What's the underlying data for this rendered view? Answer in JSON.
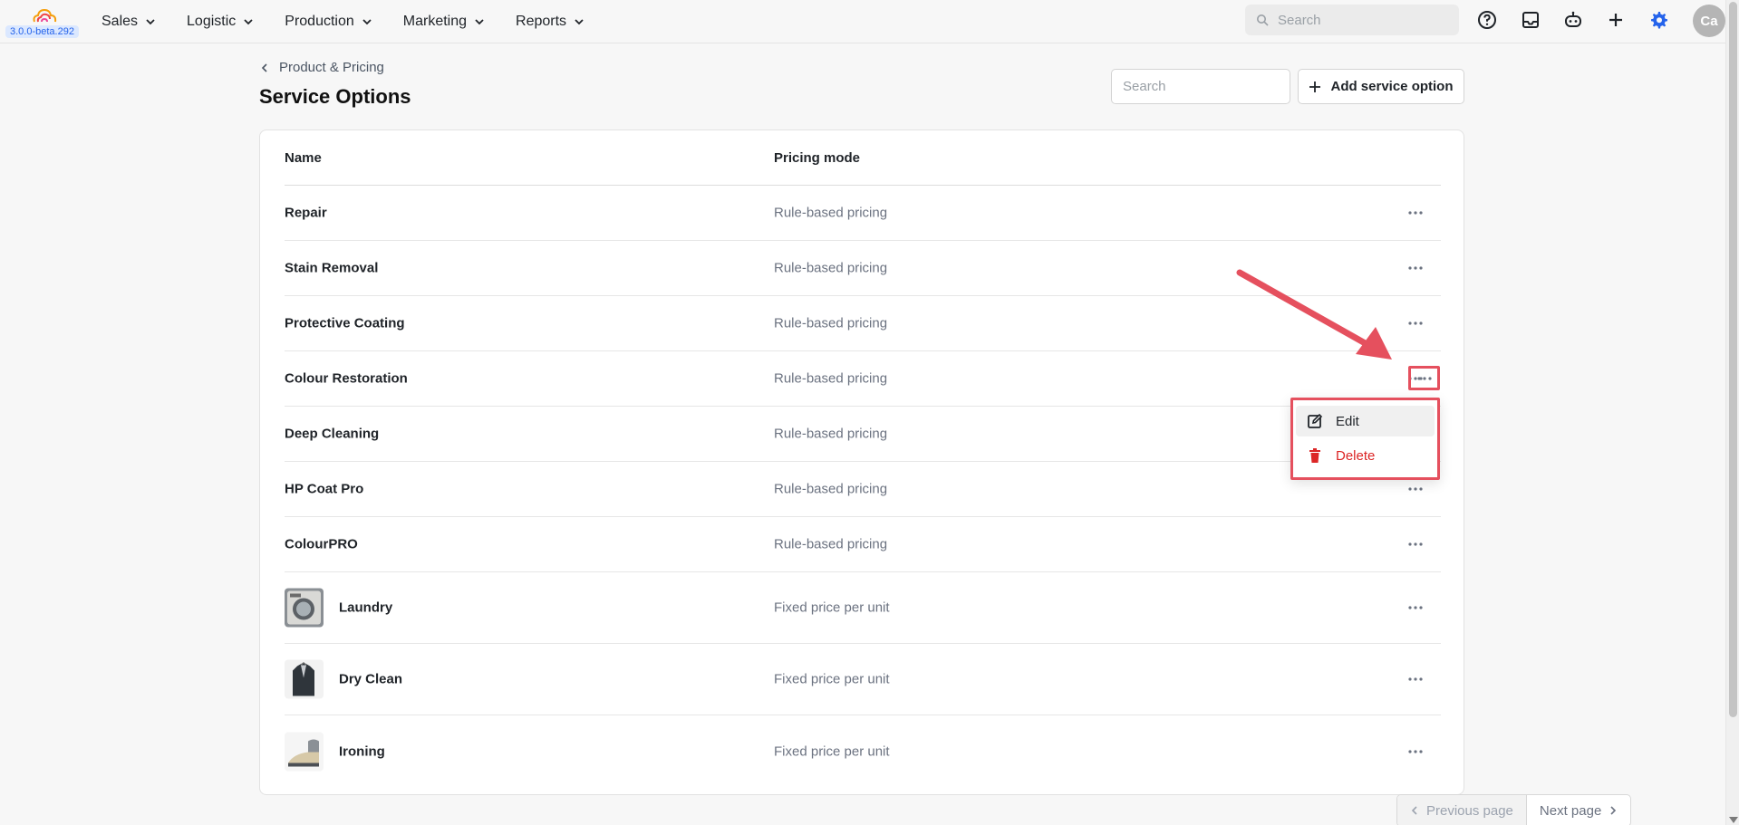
{
  "app": {
    "version": "3.0.0-beta.292"
  },
  "nav": {
    "items": [
      {
        "label": "Sales"
      },
      {
        "label": "Logistic"
      },
      {
        "label": "Production"
      },
      {
        "label": "Marketing"
      },
      {
        "label": "Reports"
      }
    ]
  },
  "topbar": {
    "search_placeholder": "Search",
    "avatar_initials": "Ca",
    "icons": [
      "help-icon",
      "inbox-icon",
      "robot-icon",
      "plus-icon",
      "settings-icon"
    ],
    "settings_color": "#2563eb"
  },
  "page": {
    "breadcrumb": "Product & Pricing",
    "title": "Service Options",
    "search_placeholder": "Search",
    "add_button_label": "Add service option"
  },
  "table": {
    "columns": {
      "name": "Name",
      "pricing_mode": "Pricing mode"
    },
    "rows": [
      {
        "name": "Repair",
        "pricing_mode": "Rule-based pricing",
        "thumb": ""
      },
      {
        "name": "Stain Removal",
        "pricing_mode": "Rule-based pricing",
        "thumb": ""
      },
      {
        "name": "Protective Coating",
        "pricing_mode": "Rule-based pricing",
        "thumb": ""
      },
      {
        "name": "Colour Restoration",
        "pricing_mode": "Rule-based pricing",
        "thumb": ""
      },
      {
        "name": "Deep Cleaning",
        "pricing_mode": "Rule-based pricing",
        "thumb": ""
      },
      {
        "name": "HP Coat Pro",
        "pricing_mode": "Rule-based pricing",
        "thumb": ""
      },
      {
        "name": "ColourPRO",
        "pricing_mode": "Rule-based pricing",
        "thumb": ""
      },
      {
        "name": "Laundry",
        "pricing_mode": "Fixed price per unit",
        "thumb": "washing-machine"
      },
      {
        "name": "Dry Clean",
        "pricing_mode": "Fixed price per unit",
        "thumb": "suit-jacket"
      },
      {
        "name": "Ironing",
        "pricing_mode": "Fixed price per unit",
        "thumb": "iron"
      }
    ]
  },
  "row_menu": {
    "edit_label": "Edit",
    "delete_label": "Delete",
    "delete_color": "#dc2626",
    "highlight_color": "#e5505e"
  },
  "pagination": {
    "prev_label": "Previous page",
    "next_label": "Next page"
  }
}
